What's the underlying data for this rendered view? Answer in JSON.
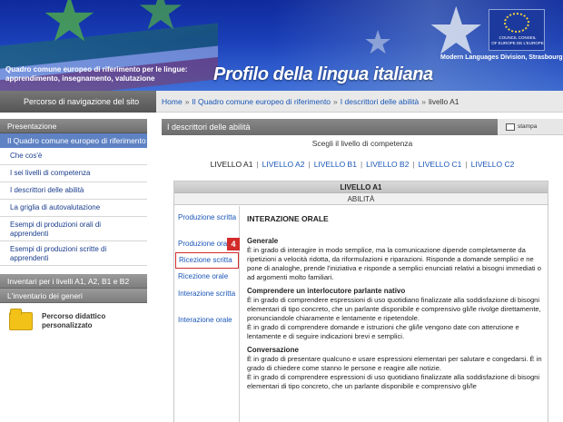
{
  "header": {
    "tagline_line1": "Quadro comune europeo di riferimento per le lingue:",
    "tagline_line2": "apprendimento, insegnamento, valutazione",
    "title": "Profilo della lingua italiana",
    "coe_text_1": "COUNCIL    CONSEIL",
    "coe_text_2": "OF EUROPE  DE L'EUROPE",
    "division": "Modern Languages Division, Strasbourg"
  },
  "navbar": {
    "left_label": "Percorso di navigazione del sito",
    "crumbs": [
      "Home",
      "Il Quadro comune europeo di riferimento",
      "I descrittori delle abilità",
      "livello A1"
    ],
    "sep": "»"
  },
  "sidebar": {
    "section1": "Presentazione",
    "active": "Il Quadro comune europeo di riferimento",
    "items": [
      "Che cos'è",
      "I sei livelli di competenza",
      "I descrittori delle abilità",
      "La griglia di autovalutazione",
      "Esempi di produzioni orali di apprendenti",
      "Esempi di produzioni scritte di apprendenti"
    ],
    "section2": "Inventari per i livelli A1, A2, B1 e B2",
    "section3": "L'inventario dei generi",
    "folder_label": "Percorso didattico personalizzato"
  },
  "main": {
    "heading": "I descrittori delle abilità",
    "print_label": "stampa",
    "choose_label": "Scegli il livello di competenza",
    "levels": [
      "LIVELLO A1",
      "LIVELLO A2",
      "LIVELLO B1",
      "LIVELLO B2",
      "LIVELLO C1",
      "LIVELLO C2"
    ],
    "level_sep": "|"
  },
  "table": {
    "level": "LIVELLO A1",
    "abilities": "ABILITÀ",
    "tabs": [
      "Produzione scritta",
      "Produzione orale",
      "Ricezione scritta",
      "Ricezione orale",
      "Interazione scritta",
      "Interazione orale"
    ],
    "badge": "4",
    "content_title": "INTERAZIONE ORALE",
    "sections": [
      {
        "heading": "Generale",
        "text": "È in grado di interagire in modo semplice, ma la comunicazione dipende completamente da ripetizioni a velocità ridotta, da riformulazioni e riparazioni. Risponde a domande semplici e ne pone di analoghe, prende l'iniziativa e risponde a semplici enunciati relativi a bisogni immediati o ad argomenti molto familiari."
      },
      {
        "heading": "Comprendere un interlocutore parlante nativo",
        "text": "È in grado di comprendere espressioni di uso quotidiano finalizzate alla soddisfazione di bisogni elementari di tipo concreto, che un parlante disponibile e comprensivo gli/le rivolge direttamente, pronunciandole chiaramente e lentamente e ripetendole.",
        "text2": "È in grado di comprendere domande e istruzioni che gli/le vengono date con attenzione e lentamente e di seguire indicazioni brevi e semplici."
      },
      {
        "heading": "Conversazione",
        "text": "È in grado di presentare qualcuno e usare espressioni elementari per salutare e congedarsi. È in grado di chiedere come stanno le persone e reagire alle notizie.",
        "text2": "È in grado di comprendere espressioni di uso quotidiano finalizzate alla soddisfazione di bisogni elementari di tipo concreto, che un parlante disponibile e comprensivo gli/le"
      }
    ]
  }
}
